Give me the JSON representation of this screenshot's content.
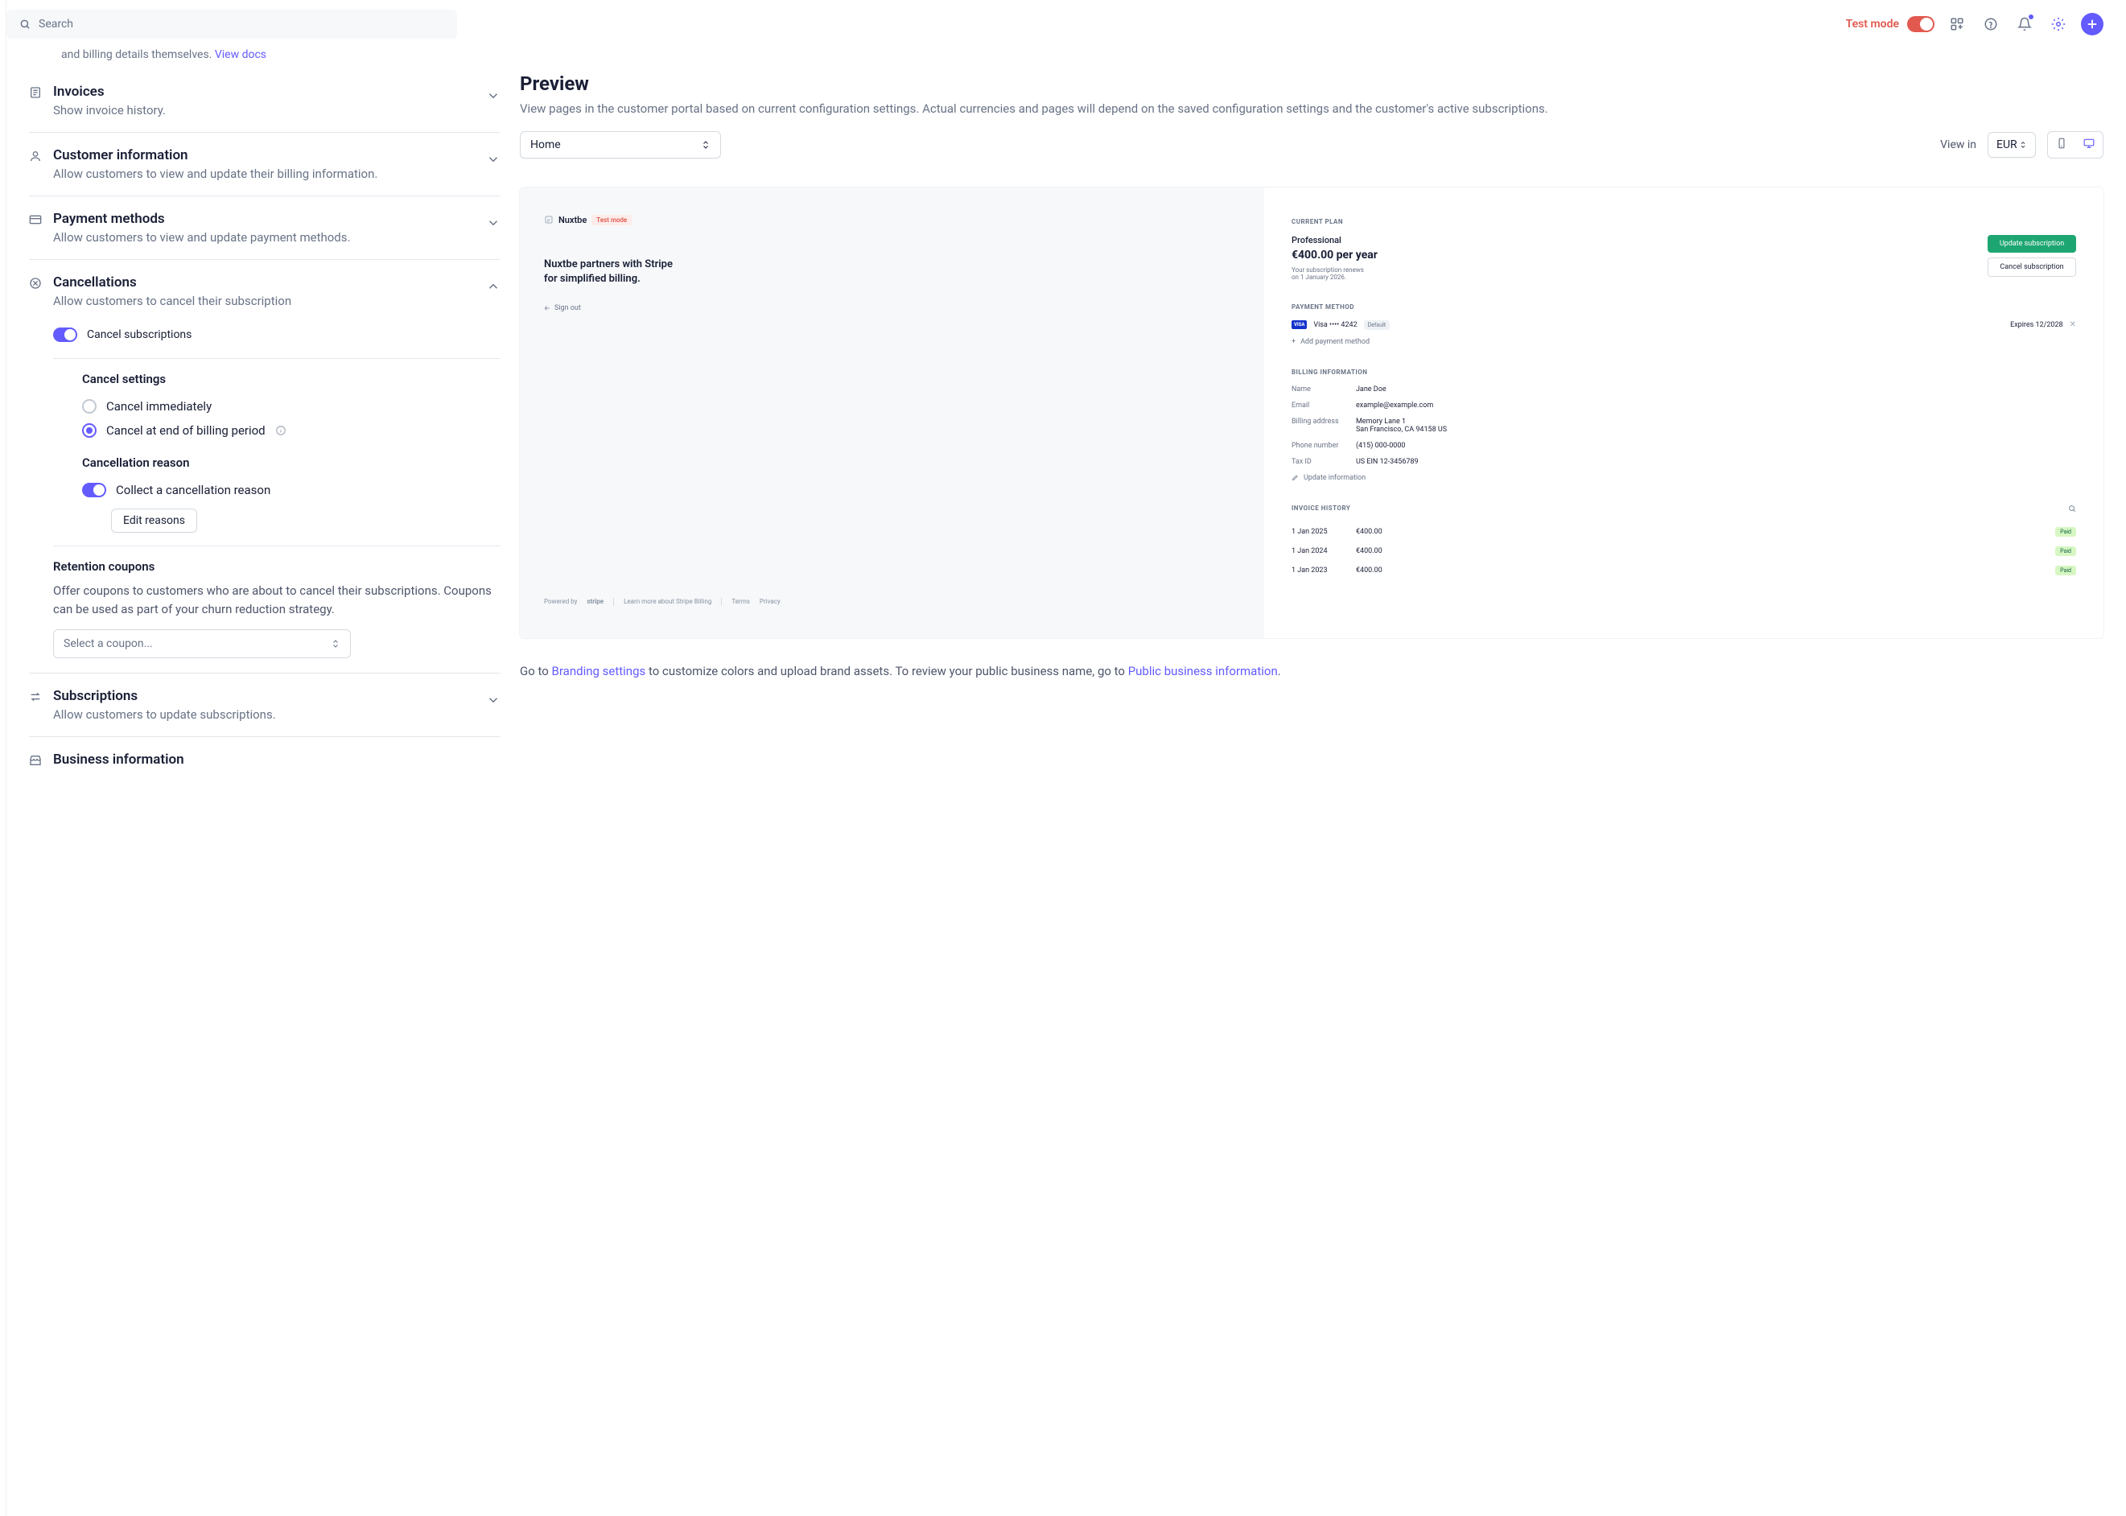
{
  "header": {
    "search_placeholder": "Search",
    "test_mode": "Test mode"
  },
  "partial_row": {
    "text_end": "and billing details themselves.",
    "link": "View docs"
  },
  "sections": {
    "invoices": {
      "title": "Invoices",
      "desc": "Show invoice history."
    },
    "customer_info": {
      "title": "Customer information",
      "desc": "Allow customers to view and update their billing information."
    },
    "payment_methods": {
      "title": "Payment methods",
      "desc": "Allow customers to view and update payment methods."
    },
    "cancellations": {
      "title": "Cancellations",
      "desc": "Allow customers to cancel their subscription",
      "cancel_subs_label": "Cancel subscriptions",
      "cancel_settings_title": "Cancel settings",
      "opt_immediately": "Cancel immediately",
      "opt_end_period": "Cancel at end of billing period",
      "reason_title": "Cancellation reason",
      "collect_reason": "Collect a cancellation reason",
      "edit_reasons": "Edit reasons",
      "retention_title": "Retention coupons",
      "retention_desc": "Offer coupons to customers who are about to cancel their subscriptions. Coupons can be used as part of your churn reduction strategy.",
      "retention_placeholder": "Select a coupon..."
    },
    "subscriptions": {
      "title": "Subscriptions",
      "desc": "Allow customers to update subscriptions."
    },
    "business_info": {
      "title": "Business information"
    }
  },
  "preview": {
    "title": "Preview",
    "desc": "View pages in the customer portal based on current configuration settings. Actual currencies and pages will depend on the saved configuration settings and the customer's active subscriptions.",
    "page_select": "Home",
    "view_in": "View in",
    "currency": "EUR"
  },
  "portal": {
    "brand": "Nuxtbe",
    "test_badge": "Test mode",
    "tagline": "Nuxtbe partners with Stripe for simplified billing.",
    "sign_out": "Sign out",
    "powered_by": "Powered by",
    "stripe": "stripe",
    "learn_more": "Learn more about Stripe Billing",
    "terms": "Terms",
    "privacy": "Privacy",
    "current_plan_label": "CURRENT PLAN",
    "plan_name": "Professional",
    "plan_price": "€400.00 per year",
    "plan_renew": "Your subscription renews on 1 January 2026.",
    "update_sub": "Update subscription",
    "cancel_sub": "Cancel subscription",
    "pm_label": "PAYMENT METHOD",
    "card_brand": "VISA",
    "card_text": "Visa •••• 4242",
    "default": "Default",
    "expires": "Expires 12/2028",
    "add_pm": "Add payment method",
    "billing_label": "BILLING INFORMATION",
    "billing": {
      "name_k": "Name",
      "name_v": "Jane Doe",
      "email_k": "Email",
      "email_v": "example@example.com",
      "addr_k": "Billing address",
      "addr_v1": "Memory Lane 1",
      "addr_v2": "San Francisco, CA 94158 US",
      "phone_k": "Phone number",
      "phone_v": "(415) 000-0000",
      "tax_k": "Tax ID",
      "tax_v": "US EIN 12-3456789"
    },
    "update_info": "Update information",
    "inv_label": "INVOICE HISTORY",
    "invoices": [
      {
        "date": "1 Jan 2025",
        "amount": "€400.00",
        "status": "Paid"
      },
      {
        "date": "1 Jan 2024",
        "amount": "€400.00",
        "status": "Paid"
      },
      {
        "date": "1 Jan 2023",
        "amount": "€400.00",
        "status": "Paid"
      }
    ]
  },
  "footer": {
    "pre1": "Go to ",
    "link1": "Branding settings",
    "mid1": " to customize colors and upload brand assets. To review your public business name, go to ",
    "link2": "Public business information",
    "end": "."
  }
}
